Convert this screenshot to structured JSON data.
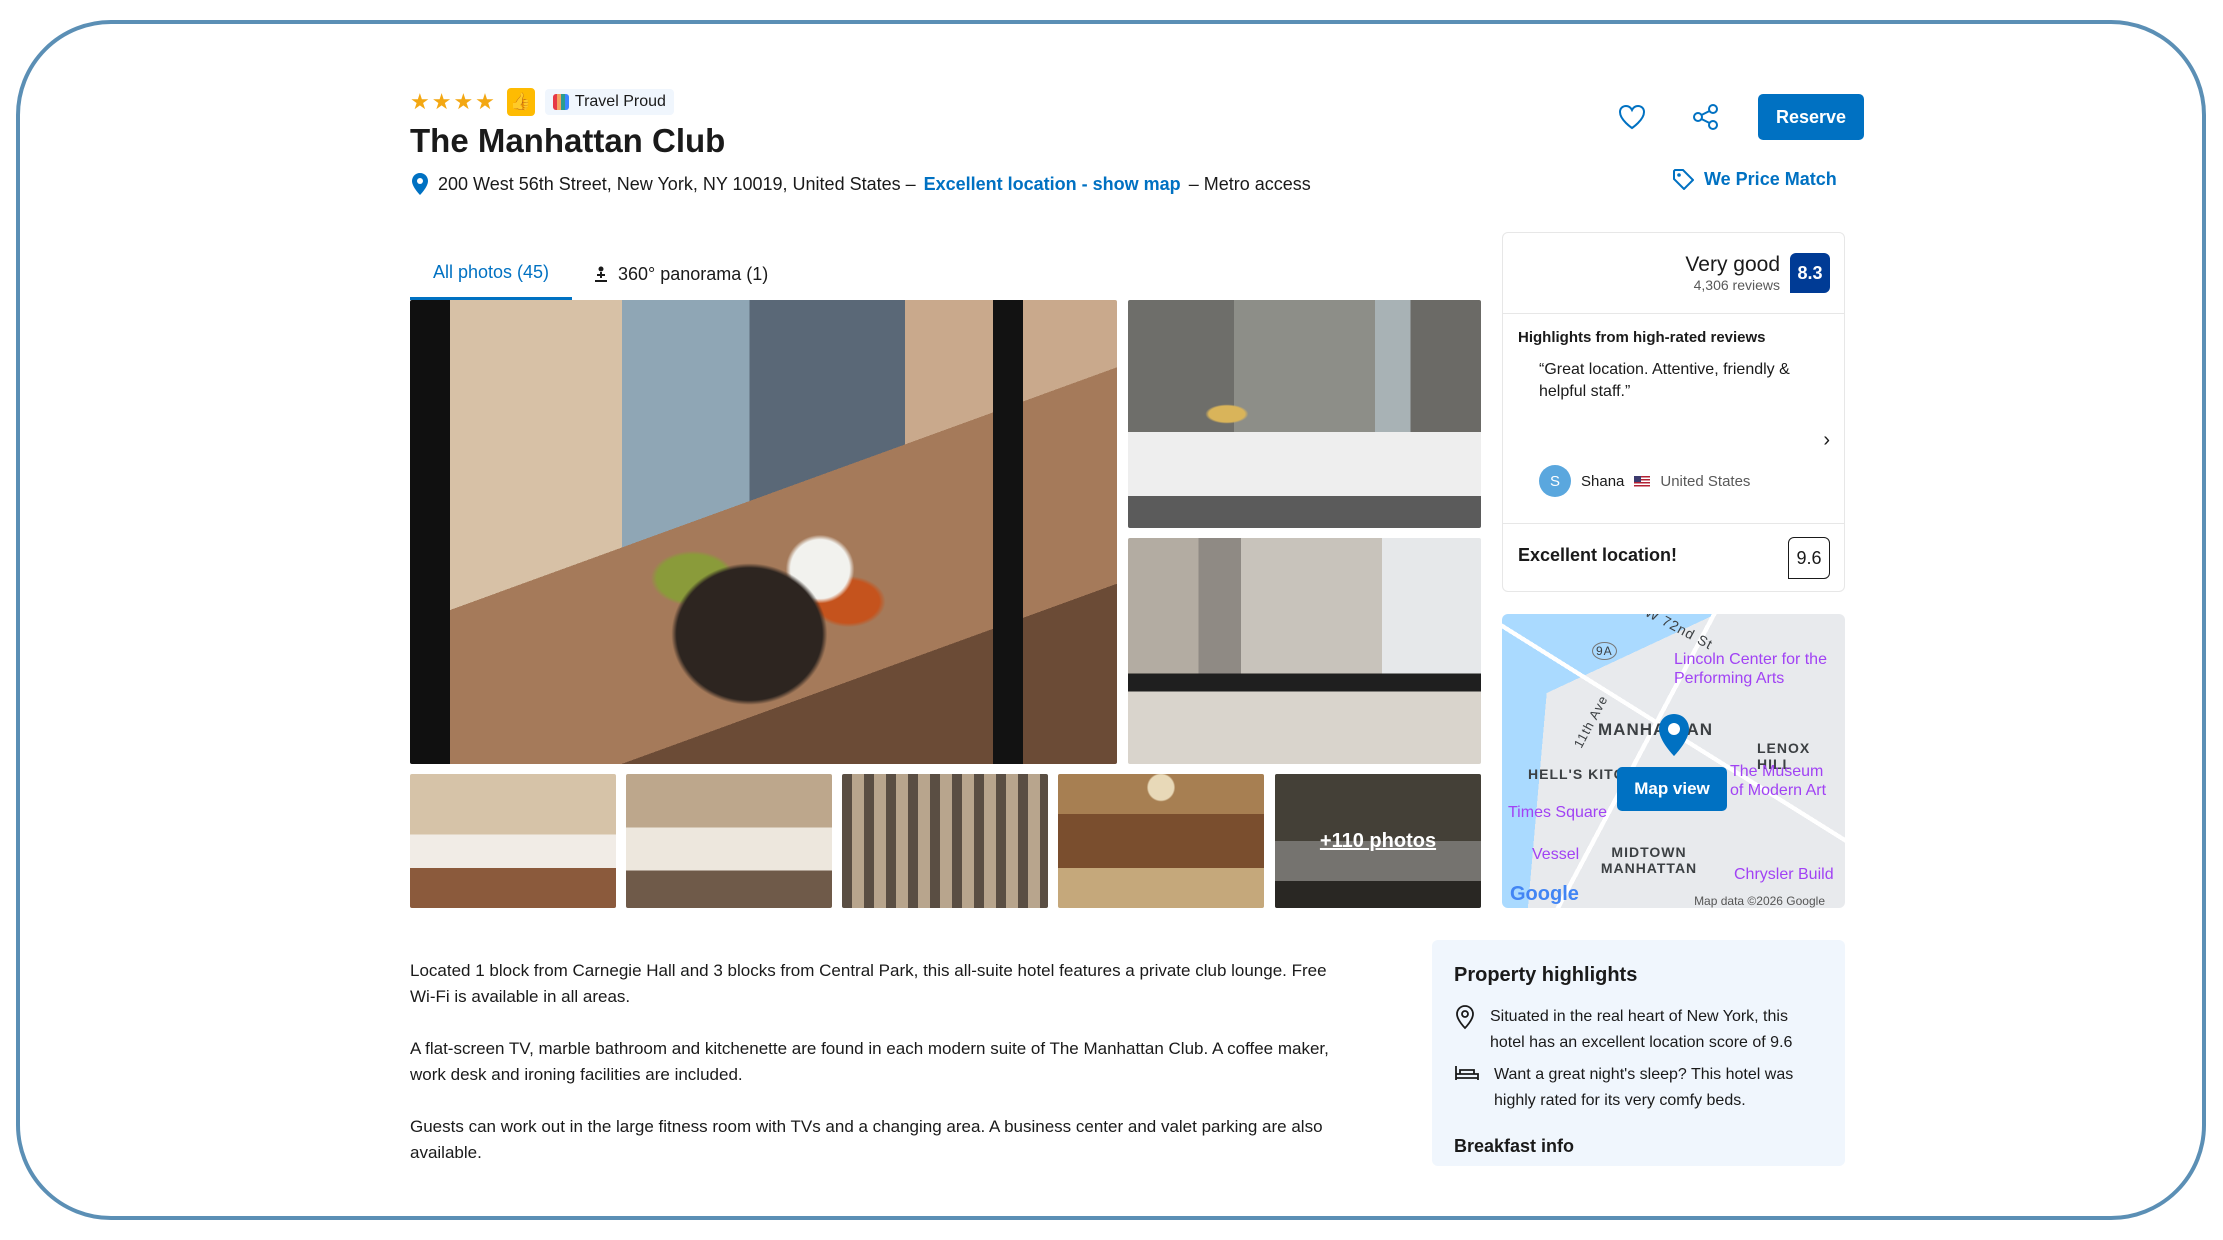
{
  "header": {
    "stars": "★★★★",
    "travel_proud": "Travel Proud",
    "title": "The Manhattan Club",
    "address": "200 West 56th Street, New York, NY 10019, United States –",
    "location_link": "Excellent location - show map",
    "metro": "– Metro access"
  },
  "actions": {
    "reserve": "Reserve",
    "price_match": "We Price Match"
  },
  "tabs": [
    {
      "label": "All photos (45)"
    },
    {
      "label": "360° panorama (1)"
    }
  ],
  "photos": {
    "more": "+110 photos"
  },
  "review": {
    "rating_word": "Very good",
    "review_count": "4,306 reviews",
    "score": "8.3",
    "highlights_title": "Highlights from high-rated reviews",
    "quote": "“Great location. Attentive, friendly & helpful staff.”",
    "reviewer_initial": "S",
    "reviewer_name": "Shana",
    "reviewer_country": "United States",
    "location_label": "Excellent location!",
    "location_score": "9.6"
  },
  "map": {
    "street_1": "W 72nd St",
    "poi_lincoln": "Lincoln Center for the Performing Arts",
    "area_manhattan": "MANHATTAN",
    "area_lenox": "LENOX HILL",
    "area_hells": "HELL'S KITCHEN",
    "poi_museum": "The Museum of Modern Art",
    "poi_times": "Times Square",
    "poi_vessel": "Vessel",
    "area_midtown": "MIDTOWN MANHATTAN",
    "poi_chrysler": "Chrysler Build",
    "avenue": "11th Ave",
    "route": "9A",
    "button": "Map view",
    "credit": "Map data ©2026 Google",
    "google": "Google"
  },
  "description": [
    "Located 1 block from Carnegie Hall and 3 blocks from Central Park, this all-suite hotel features a private club lounge. Free Wi-Fi is available in all areas.",
    "A flat-screen TV, marble bathroom and kitchenette are found in each modern suite of The Manhattan Club. A coffee maker, work desk and ironing facilities are included.",
    "Guests can work out in the large fitness room with TVs and a changing area. A business center and valet parking are also available."
  ],
  "highlights": {
    "title": "Property highlights",
    "items": [
      "Situated in the real heart of New York, this hotel has an excellent location score of 9.6",
      "Want a great night's sleep? This hotel was highly rated for its very comfy beds."
    ],
    "breakfast": "Breakfast info"
  },
  "colors": {
    "primary": "#0071c2",
    "score_badge": "#003b95",
    "star": "#f3a712",
    "frame": "#5b8fb5"
  }
}
